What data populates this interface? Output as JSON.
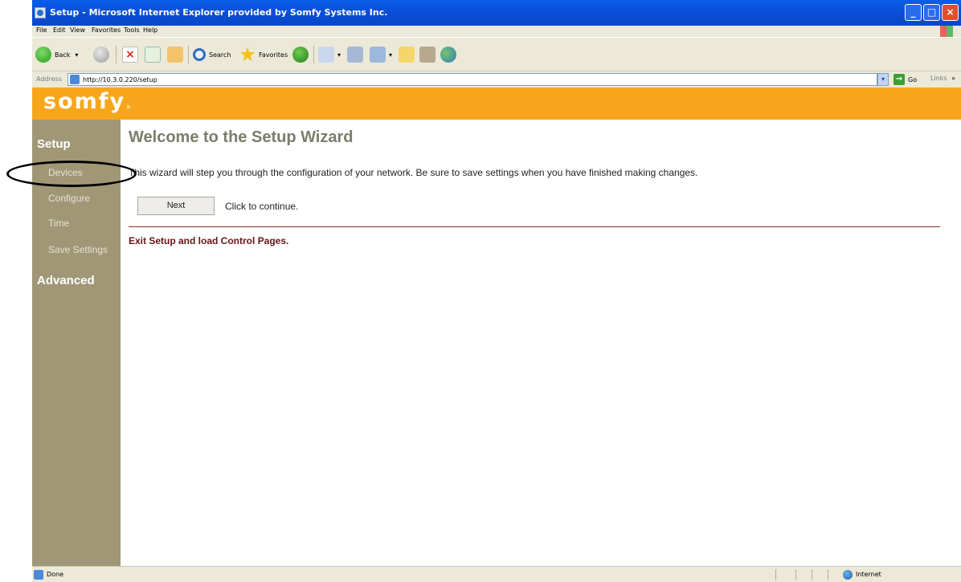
{
  "window": {
    "title": "Setup - Microsoft Internet Explorer provided by Somfy Systems Inc.",
    "controls": {
      "minimize": "_",
      "maximize": "□",
      "close": "×"
    }
  },
  "menu": [
    "File",
    "Edit",
    "View",
    "Favorites",
    "Tools",
    "Help"
  ],
  "toolbar": {
    "back_label": "Back",
    "search_label": "Search",
    "favorites_label": "Favorites",
    "dropdown_glyph": "▾"
  },
  "address": {
    "label": "Address",
    "url": "http://10.3.0.220/setup",
    "go_label": "Go",
    "links_label": "Links",
    "links_glyph": "»"
  },
  "brand": {
    "logo_text": "somfy",
    "logo_dot": "."
  },
  "sidebar": {
    "setup_heading": "Setup",
    "items": [
      {
        "label": "Devices"
      },
      {
        "label": "Configure"
      },
      {
        "label": "Time"
      },
      {
        "label": "Save Settings"
      }
    ],
    "advanced_heading": "Advanced"
  },
  "main": {
    "title": "Welcome to the Setup Wizard",
    "intro": "This wizard will step you through the configuration of your network. Be sure to save settings when you have finished making changes.",
    "next_button": "Next",
    "next_hint": "Click to continue.",
    "exit_link": "Exit Setup and load Control Pages."
  },
  "status": {
    "text": "Done",
    "zone": "Internet"
  }
}
